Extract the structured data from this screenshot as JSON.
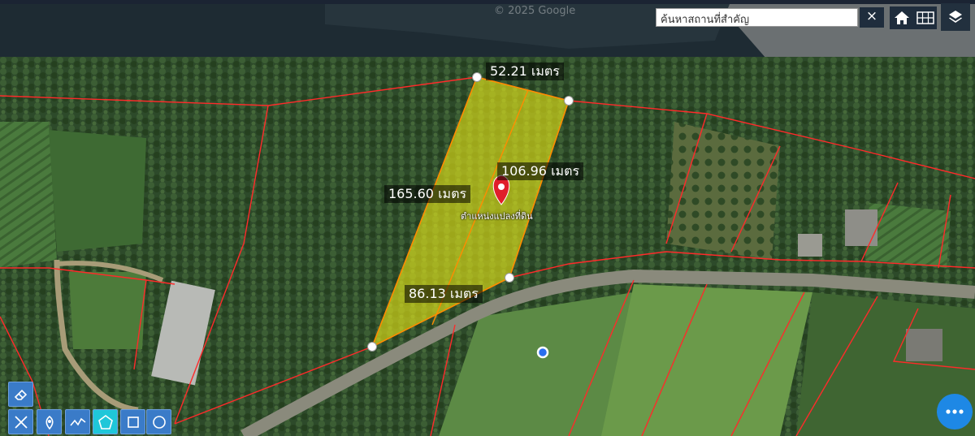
{
  "map": {
    "watermark": "© 2025 Google",
    "measurements": {
      "top": "52.21 เมตร",
      "left": "165.60 เมตร",
      "right": "106.96 เมตร",
      "bottom": "86.13 เมตร"
    },
    "pin_label": "ตำแหน่งแปลงที่ดิน",
    "parcel_fill": "#e6e619",
    "parcel_line": "#ff8c00",
    "boundary_line": "#ff2a2a"
  },
  "search": {
    "value": "ค้นหาสถานที่สำคัญ",
    "close_label": "×"
  },
  "toolbar": {
    "home_icon": "home-icon",
    "grid_icon": "grid-icon",
    "layers_icon": "layers-icon"
  },
  "draw_tools": [
    {
      "icon": "eraser-icon"
    },
    {
      "icon": "tools-icon"
    },
    {
      "icon": "pin-icon"
    },
    {
      "icon": "polyline-icon"
    },
    {
      "icon": "polygon-icon",
      "active": true
    },
    {
      "icon": "rectangle-icon"
    },
    {
      "icon": "circle-icon"
    }
  ],
  "fab": {
    "icon": "more-icon"
  }
}
